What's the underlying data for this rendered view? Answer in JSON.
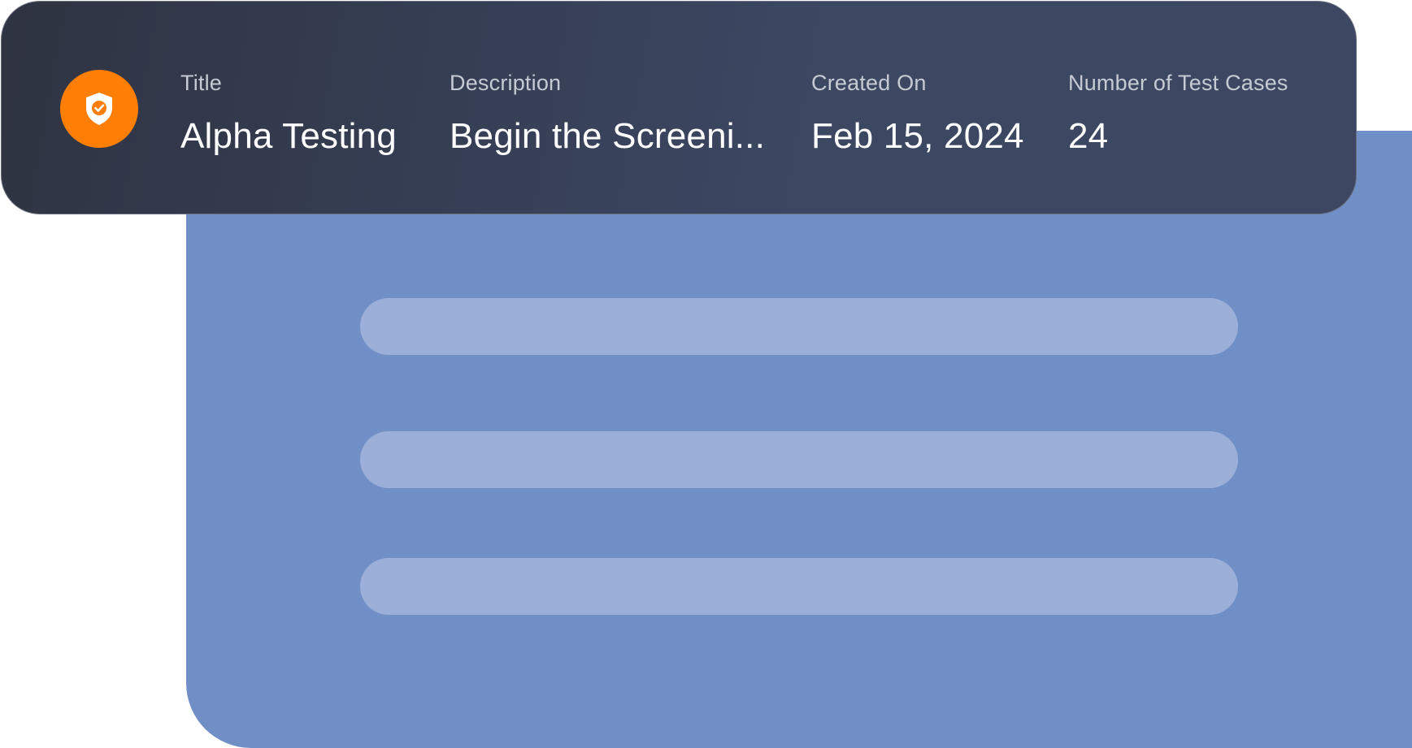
{
  "card": {
    "icon": "shield-check-icon",
    "accent_color": "#ff7e05",
    "fields": {
      "title": {
        "label": "Title",
        "value": "Alpha Testing"
      },
      "description": {
        "label": "Description",
        "value": "Begin the Screeni..."
      },
      "created_on": {
        "label": "Created On",
        "value": "Feb 15, 2024"
      },
      "test_cases": {
        "label": "Number of Test Cases",
        "value": "24"
      }
    }
  },
  "panel": {
    "background_color": "#708fc7",
    "placeholder_bar_color": "#9bafd9",
    "placeholder_bar_count": 3
  }
}
